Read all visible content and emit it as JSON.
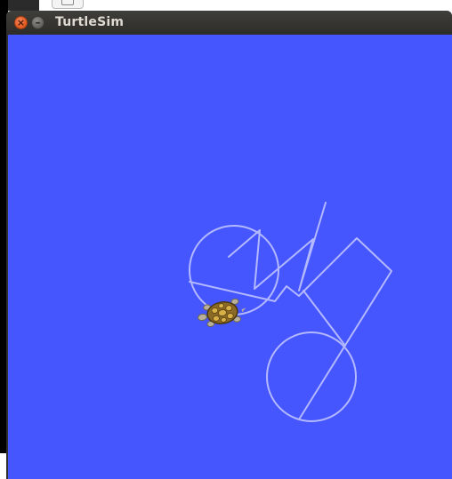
{
  "window": {
    "title": "TurtleSim",
    "close_glyph": "×",
    "minimize_glyph": "–"
  },
  "icons": {
    "close": "close-icon",
    "minimize": "minimize-icon",
    "turtle": "turtle-icon"
  },
  "colors": {
    "canvas_background": "#4556ff",
    "pen": "#b3b8ff",
    "titlebar": "#3a3936",
    "close_button": "#e8622a"
  }
}
